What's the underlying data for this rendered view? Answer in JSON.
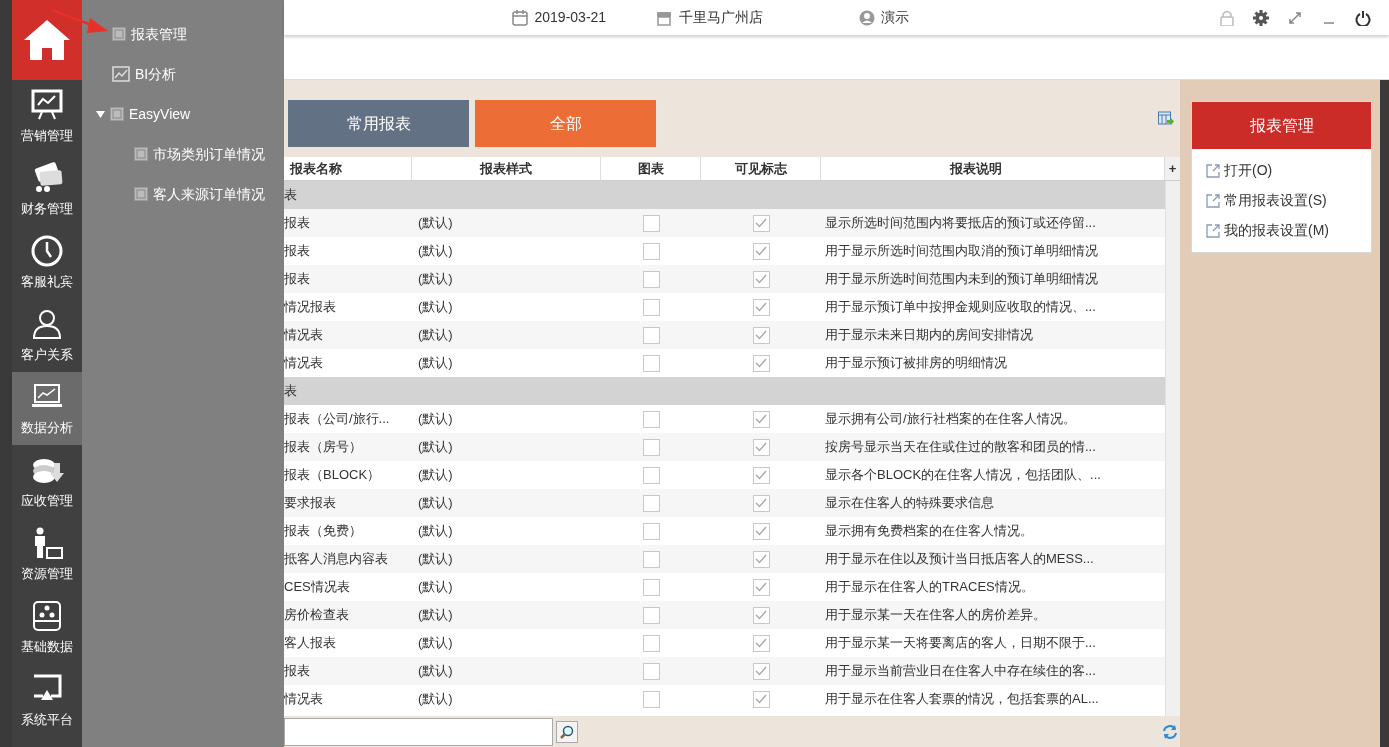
{
  "top_bar": {
    "date": "2019-03-21",
    "hotel": "千里马广州店",
    "user": "演示"
  },
  "rail": {
    "items": [
      {
        "label": "营销管理",
        "selected": false
      },
      {
        "label": "财务管理",
        "selected": false
      },
      {
        "label": "客服礼宾",
        "selected": false
      },
      {
        "label": "客户关系",
        "selected": false
      },
      {
        "label": "数据分析",
        "selected": true
      },
      {
        "label": "应收管理",
        "selected": false
      },
      {
        "label": "资源管理",
        "selected": false
      },
      {
        "label": "基础数据",
        "selected": false
      },
      {
        "label": "系统平台",
        "selected": false
      }
    ]
  },
  "flyout": {
    "items": [
      {
        "label": "报表管理",
        "kind": "report"
      },
      {
        "label": "BI分析",
        "kind": "chart"
      },
      {
        "label": "EasyView",
        "kind": "report",
        "expanded": true,
        "children": [
          {
            "label": "市场类别订单情况",
            "kind": "report"
          },
          {
            "label": "客人来源订单情况",
            "kind": "report"
          }
        ]
      }
    ]
  },
  "tabs": [
    {
      "label": "常用报表",
      "selected": false
    },
    {
      "label": "全部",
      "selected": true
    }
  ],
  "table": {
    "columns": [
      "报表名称",
      "报表样式",
      "图表",
      "可见标志",
      "报表说明"
    ],
    "add_column": "+",
    "rows": [
      {
        "kind": "group",
        "name": "表"
      },
      {
        "kind": "report",
        "name": "报表",
        "style": "(默认)",
        "chart": false,
        "visible": true,
        "description": "显示所选时间范围内将要抵店的预订或还停留..."
      },
      {
        "kind": "report",
        "name": "报表",
        "style": "(默认)",
        "chart": false,
        "visible": true,
        "description": "用于显示所选时间范围内取消的预订单明细情况"
      },
      {
        "kind": "report",
        "name": "报表",
        "style": "(默认)",
        "chart": false,
        "visible": true,
        "description": "用于显示所选时间范围内未到的预订单明细情况"
      },
      {
        "kind": "report",
        "name": "情况报表",
        "style": "(默认)",
        "chart": false,
        "visible": true,
        "description": "用于显示预订单中按押金规则应收取的情况、..."
      },
      {
        "kind": "report",
        "name": "情况表",
        "style": "(默认)",
        "chart": false,
        "visible": true,
        "description": "用于显示未来日期内的房间安排情况"
      },
      {
        "kind": "report",
        "name": "情况表",
        "style": "(默认)",
        "chart": false,
        "visible": true,
        "description": "用于显示预订被排房的明细情况"
      },
      {
        "kind": "group",
        "name": "表"
      },
      {
        "kind": "report",
        "name": "报表（公司/旅行...",
        "style": "(默认)",
        "chart": false,
        "visible": true,
        "description": "显示拥有公司/旅行社档案的在住客人情况。"
      },
      {
        "kind": "report",
        "name": "报表（房号）",
        "style": "(默认)",
        "chart": false,
        "visible": true,
        "description": "按房号显示当天在住或住过的散客和团员的情..."
      },
      {
        "kind": "report",
        "name": "报表（BLOCK）",
        "style": "(默认)",
        "chart": false,
        "visible": true,
        "description": "显示各个BLOCK的在住客人情况，包括团队、..."
      },
      {
        "kind": "report",
        "name": "要求报表",
        "style": "(默认)",
        "chart": false,
        "visible": true,
        "description": "显示在住客人的特殊要求信息"
      },
      {
        "kind": "report",
        "name": "报表（免费）",
        "style": "(默认)",
        "chart": false,
        "visible": true,
        "description": "显示拥有免费档案的在住客人情况。"
      },
      {
        "kind": "report",
        "name": "抵客人消息内容表",
        "style": "(默认)",
        "chart": false,
        "visible": true,
        "description": "用于显示在住以及预计当日抵店客人的MESS..."
      },
      {
        "kind": "report",
        "name": "CES情况表",
        "style": "(默认)",
        "chart": false,
        "visible": true,
        "description": "用于显示在住客人的TRACES情况。"
      },
      {
        "kind": "report",
        "name": "房价检查表",
        "style": "(默认)",
        "chart": false,
        "visible": true,
        "description": "用于显示某一天在住客人的房价差异。"
      },
      {
        "kind": "report",
        "name": "客人报表",
        "style": "(默认)",
        "chart": false,
        "visible": true,
        "description": "用于显示某一天将要离店的客人，日期不限于..."
      },
      {
        "kind": "report",
        "name": "报表",
        "style": "(默认)",
        "chart": false,
        "visible": true,
        "description": "用于显示当前营业日在住客人中存在续住的客..."
      },
      {
        "kind": "report",
        "name": "情况表",
        "style": "(默认)",
        "chart": false,
        "visible": true,
        "description": "用于显示在住客人套票的情况，包括套票的AL..."
      }
    ]
  },
  "panel": {
    "title": "报表管理",
    "actions": [
      "打开(O)",
      "常用报表设置(S)",
      "我的报表设置(M)"
    ]
  }
}
